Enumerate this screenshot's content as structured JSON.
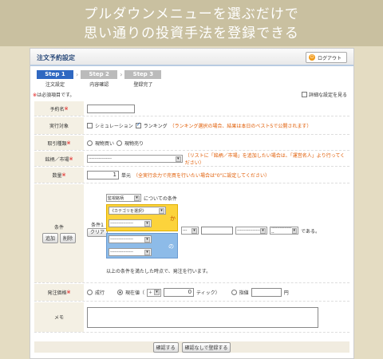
{
  "banner": {
    "line1": "プルダウンメニューを選ぶだけで",
    "line2": "思い通りの投資手法を登録できる"
  },
  "header": {
    "title": "注文予約設定",
    "logout": "ログアウト"
  },
  "steps": [
    {
      "label": "Step 1",
      "name": "注文設定"
    },
    {
      "label": "Step 2",
      "name": "内容確認"
    },
    {
      "label": "Step 3",
      "name": "登録完了"
    }
  ],
  "notice": {
    "mark": "※",
    "text": "は必須項目です。"
  },
  "detail_link": "詳細な設定を見る",
  "form": {
    "name": {
      "label": "予約名",
      "mark": "※",
      "value": ""
    },
    "target": {
      "label": "実行対象",
      "opt1": "シミュレーション",
      "opt2": "ランキング",
      "note": "（ランキング選択の場合、結果は本日のベスト5で公開されます）"
    },
    "trade": {
      "label": "取引種類",
      "mark": "※",
      "opt1": "現物買い",
      "opt2": "現物売り"
    },
    "market": {
      "label": "銘柄／市場",
      "mark": "※",
      "select": "----------------",
      "note": "（リストに「銘柄／市場」を追加したい場合は、「運営名人」より行ってください）"
    },
    "qty": {
      "label": "数量",
      "mark": "※",
      "value": "1",
      "unit": "単元",
      "note": "（全実行余力で売買を行いたい場合は\"0\"に設定してください）"
    },
    "cond": {
      "label": "条件",
      "add": "追加",
      "del": "削除",
      "id": "条件1",
      "clear": "クリア",
      "stock": "監視銘柄",
      "suffix": "についての条件",
      "category": "《カテゴリを選択》",
      "dash": "----------------",
      "ka": "か",
      "no": "の",
      "op": "---",
      "end": "である。",
      "footer": "以上の条件を満たした時点で、発注を行います。"
    },
    "price": {
      "label": "発注価格",
      "mark": "※",
      "market": "成行",
      "current": "現在値（",
      "sign": "＋",
      "ticks": "0",
      "tick": "ティック）",
      "limit": "指値",
      "yen": "円"
    },
    "memo": {
      "label": "メモ"
    }
  },
  "buttons": {
    "confirm": "確認する",
    "register": "確認なしで登録する"
  }
}
